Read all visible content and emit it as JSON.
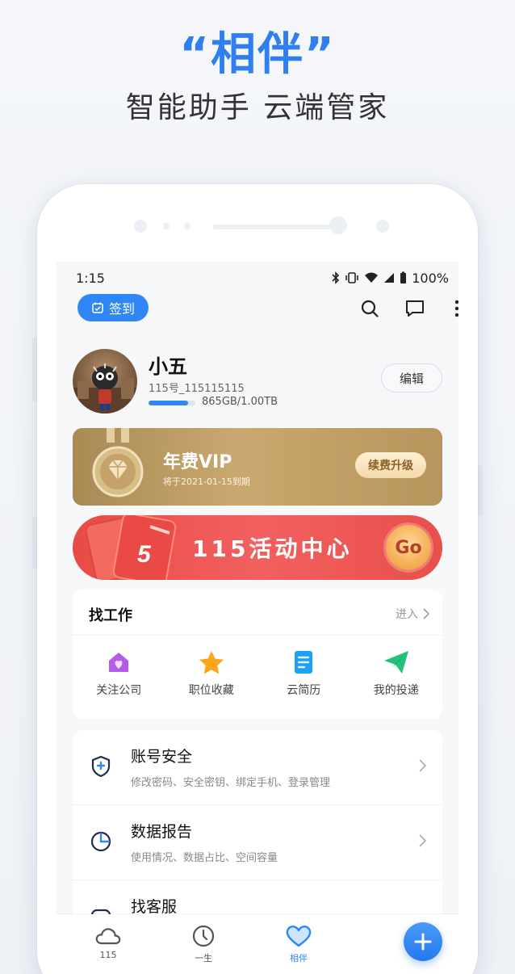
{
  "hero": {
    "title": "“相伴”",
    "subtitle": "智能助手 云端管家"
  },
  "status_bar": {
    "time": "1:15",
    "battery": "100%"
  },
  "header": {
    "checkin_label": "签到",
    "icons": [
      "search-icon",
      "message-icon",
      "more-vertical-icon"
    ]
  },
  "profile": {
    "name": "小五",
    "user_id": "115号_115115115",
    "storage_text": "865GB/1.00TB",
    "storage_fraction": 0.845,
    "edit_label": "编辑"
  },
  "vip": {
    "title": "年费VIP",
    "expiry": "将于2021-01-15到期",
    "renew_label": "续费升级"
  },
  "event": {
    "title": "115活动中心",
    "go_label": "Go"
  },
  "jobs": {
    "title": "找工作",
    "enter_label": "进入",
    "items": [
      {
        "label": "关注公司",
        "icon": "company-icon"
      },
      {
        "label": "职位收藏",
        "icon": "star-icon"
      },
      {
        "label": "云简历",
        "icon": "resume-icon"
      },
      {
        "label": "我的投递",
        "icon": "send-icon"
      }
    ]
  },
  "menu": [
    {
      "title": "账号安全",
      "subtitle": "修改密码、安全密钥、绑定手机、登录管理",
      "icon": "shield-icon"
    },
    {
      "title": "数据报告",
      "subtitle": "使用情况、数据占比、空间容量",
      "icon": "pie-chart-icon"
    },
    {
      "title": "找客服",
      "subtitle": "",
      "icon": "customer-service-icon"
    }
  ],
  "tabbar": {
    "tabs": [
      {
        "label": "115",
        "icon": "cloud-icon"
      },
      {
        "label": "一生",
        "icon": "clock-icon"
      },
      {
        "label": "相伴",
        "icon": "heart-icon"
      }
    ],
    "active": "相伴",
    "fab_icon": "plus-icon"
  },
  "colors": {
    "accent": "#2f86f6",
    "vip_gold": "#c9a96f",
    "event_red": "#e94a45"
  }
}
